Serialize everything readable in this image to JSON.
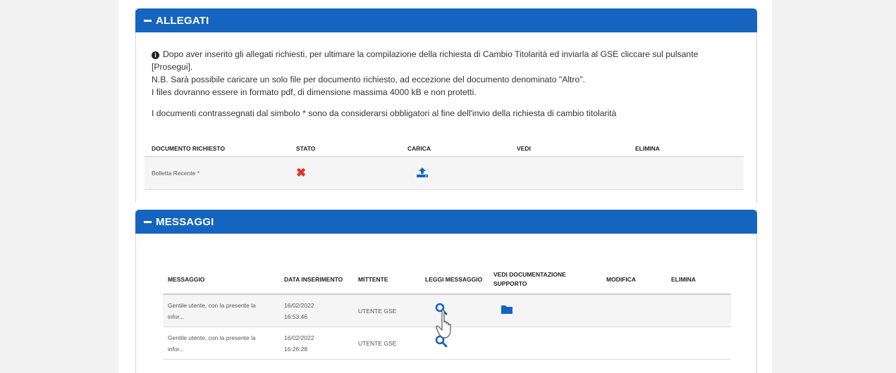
{
  "allegati": {
    "title": "ALLEGATI",
    "info_line1": "Dopo aver inserito gli allegati richiesti, per ultimare la compilazione della richiesta di Cambio Titolarità ed inviarla al GSE cliccare sul pulsante",
    "info_line2": "[Prosegui].",
    "info_line3": "N.B. Sarà possibile caricare un solo file per documento richiesto, ad eccezione del documento denominato \"Altro\".",
    "info_line4": "I files dovranno essere in formato pdf, di dimensione massima 4000 kB e non protetti.",
    "info_line5": "I documenti contrassegnati dal simbolo * sono da considerarsi obbligatori al fine dell'invio della richiesta di cambio titolarità",
    "columns": [
      "DOCUMENTO RICHIESTO",
      "STATO",
      "CARICA",
      "VEDI",
      "ELIMINA"
    ],
    "rows": [
      {
        "documento": "Bolletta Recente *",
        "stato_icon": "x-mark-icon",
        "carica_icon": "upload-icon"
      }
    ]
  },
  "messaggi": {
    "title": "MESSAGGI",
    "columns": [
      "MESSAGGIO",
      "DATA INSERIMENTO",
      "MITTENTE",
      "LEGGI MESSAGGIO",
      "VEDI DOCUMENTAZIONE SUPPORTO",
      "MODIFICA",
      "ELIMINA"
    ],
    "rows": [
      {
        "messaggio": "Gentile utente, con la presente la infor...",
        "data": "16/02/2022 16:53:46",
        "mittente": "UTENTE GSE",
        "leggi_icon": "search-icon",
        "doc_icon": "folder-icon"
      },
      {
        "messaggio": "Gentile utente, con la presente la infor...",
        "data": "16/02/2022 16:26:28",
        "mittente": "UTENTE GSE",
        "leggi_icon": "search-icon"
      }
    ]
  },
  "colors": {
    "header_blue": "#1565c0",
    "error_red": "#e03524"
  }
}
